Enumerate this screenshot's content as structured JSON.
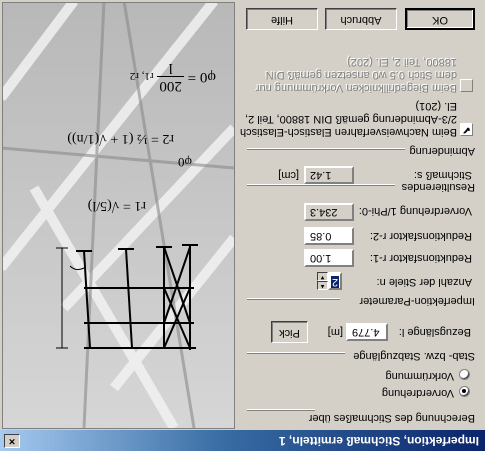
{
  "window": {
    "title": "Imperfektion, Stichmaß ermitteln, 1",
    "close_glyph": "×"
  },
  "calc_group": {
    "title": "Berechnung des Stichmaßes über",
    "options": [
      {
        "label": "Vorverdrehung",
        "selected": true
      },
      {
        "label": "Vorkrümmung",
        "selected": false
      }
    ]
  },
  "stab_group": {
    "title": "Stab- bzw. Stabzuglänge",
    "ref_length_label": "Bezugslänge l:",
    "ref_length_value": "4.779",
    "ref_length_unit": "[m]",
    "pick_label": "Pick"
  },
  "imperf_group": {
    "title": "Imperfektion-Parameter",
    "num_members_label": "Anzahl der Stiele n:",
    "num_members_value": "2",
    "r1_label": "Reduktionsfaktor r-1:",
    "r1_value": "1.00",
    "r2_label": "Reduktionsfaktor r-2:",
    "r2_value": "0.85",
    "phi0_label": "Vorverdrehung 1/Phi-0:",
    "phi0_value": "234.3"
  },
  "result_group": {
    "title": "Resultierendes",
    "stich_label": "Stichmaß s:",
    "stich_value": "1.42",
    "stich_unit": "[cm]"
  },
  "damp_group": {
    "title": "Abminderung",
    "check1_label_line1": "Beim Nachweisverfahren Elastisch-Elastisch",
    "check1_label_line2": "2/3-Abminderung gemäß DIN 18800, Teil 2,",
    "check1_label_line3": "El. (201)",
    "check1_checked": true,
    "check2_label_line1": "Beim Biegedrillknicken Vorkrümmung nur",
    "check2_label_line2": "dem Stich 0.5 w0 ansetzen gemäß DIN",
    "check2_label_line3": "18800, Teil 2, El. (202)",
    "check2_checked": false
  },
  "buttons": {
    "ok": "OK",
    "cancel": "Abbruch",
    "help": "Hilfe"
  },
  "formulas": {
    "phi0": "φ0 = 200 / l , r1 , r2",
    "phi0_lhs": "φ0",
    "phi0_num": "200",
    "phi0_den": "l",
    "phi0_tail": "r1, r2",
    "r2_expr": "r2 = ½ (1 + √(1/n))",
    "r2_lhs": "r2",
    "r1_expr": "r1 = √(5/l)",
    "r1_lhs": "r1",
    "diagram_angle": "φ0"
  },
  "colors": {
    "face": "#d4d0c8",
    "titlebar": "#0a246a",
    "image_bg": "#c9c9c9"
  }
}
